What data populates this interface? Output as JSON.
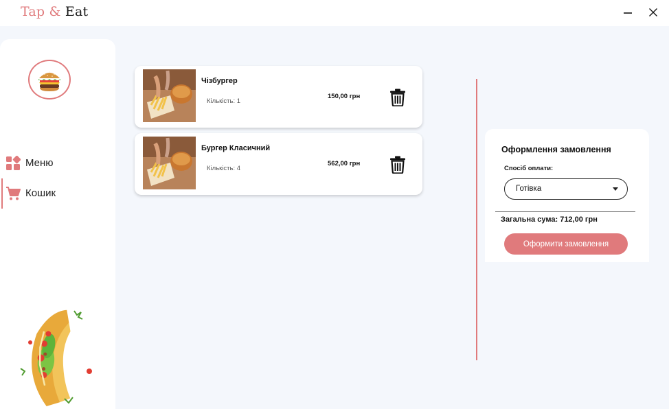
{
  "app": {
    "logo_tap": "Tap",
    "logo_amp": "&",
    "logo_eat": "Eat",
    "accent_color": "#e07a7c"
  },
  "window": {
    "minimize_icon": "minimize-icon",
    "close_icon": "close-icon"
  },
  "sidebar": {
    "avatar_icon": "burger-icon",
    "items": [
      {
        "label": "Меню",
        "icon": "menu-grid-icon",
        "active": false
      },
      {
        "label": "Кошик",
        "icon": "cart-icon",
        "active": true
      }
    ],
    "decor_icon": "taco-illustration"
  },
  "cart": {
    "items": [
      {
        "name": "Чізбургер",
        "qty_label": "Кількість: 1",
        "price": "150,00 грн",
        "thumb_icon": "food-photo",
        "delete_icon": "trash-icon"
      },
      {
        "name": "Бургер Класичний",
        "qty_label": "Кількість: 4",
        "price": "562,00 грн",
        "thumb_icon": "food-photo",
        "delete_icon": "trash-icon"
      }
    ]
  },
  "checkout": {
    "title": "Оформлення замовлення",
    "payment_label": "Спосіб оплати:",
    "payment_value": "Готівка",
    "total_label": "Загальна сума: 712,00 грн",
    "submit_label": "Оформити замовлення"
  }
}
